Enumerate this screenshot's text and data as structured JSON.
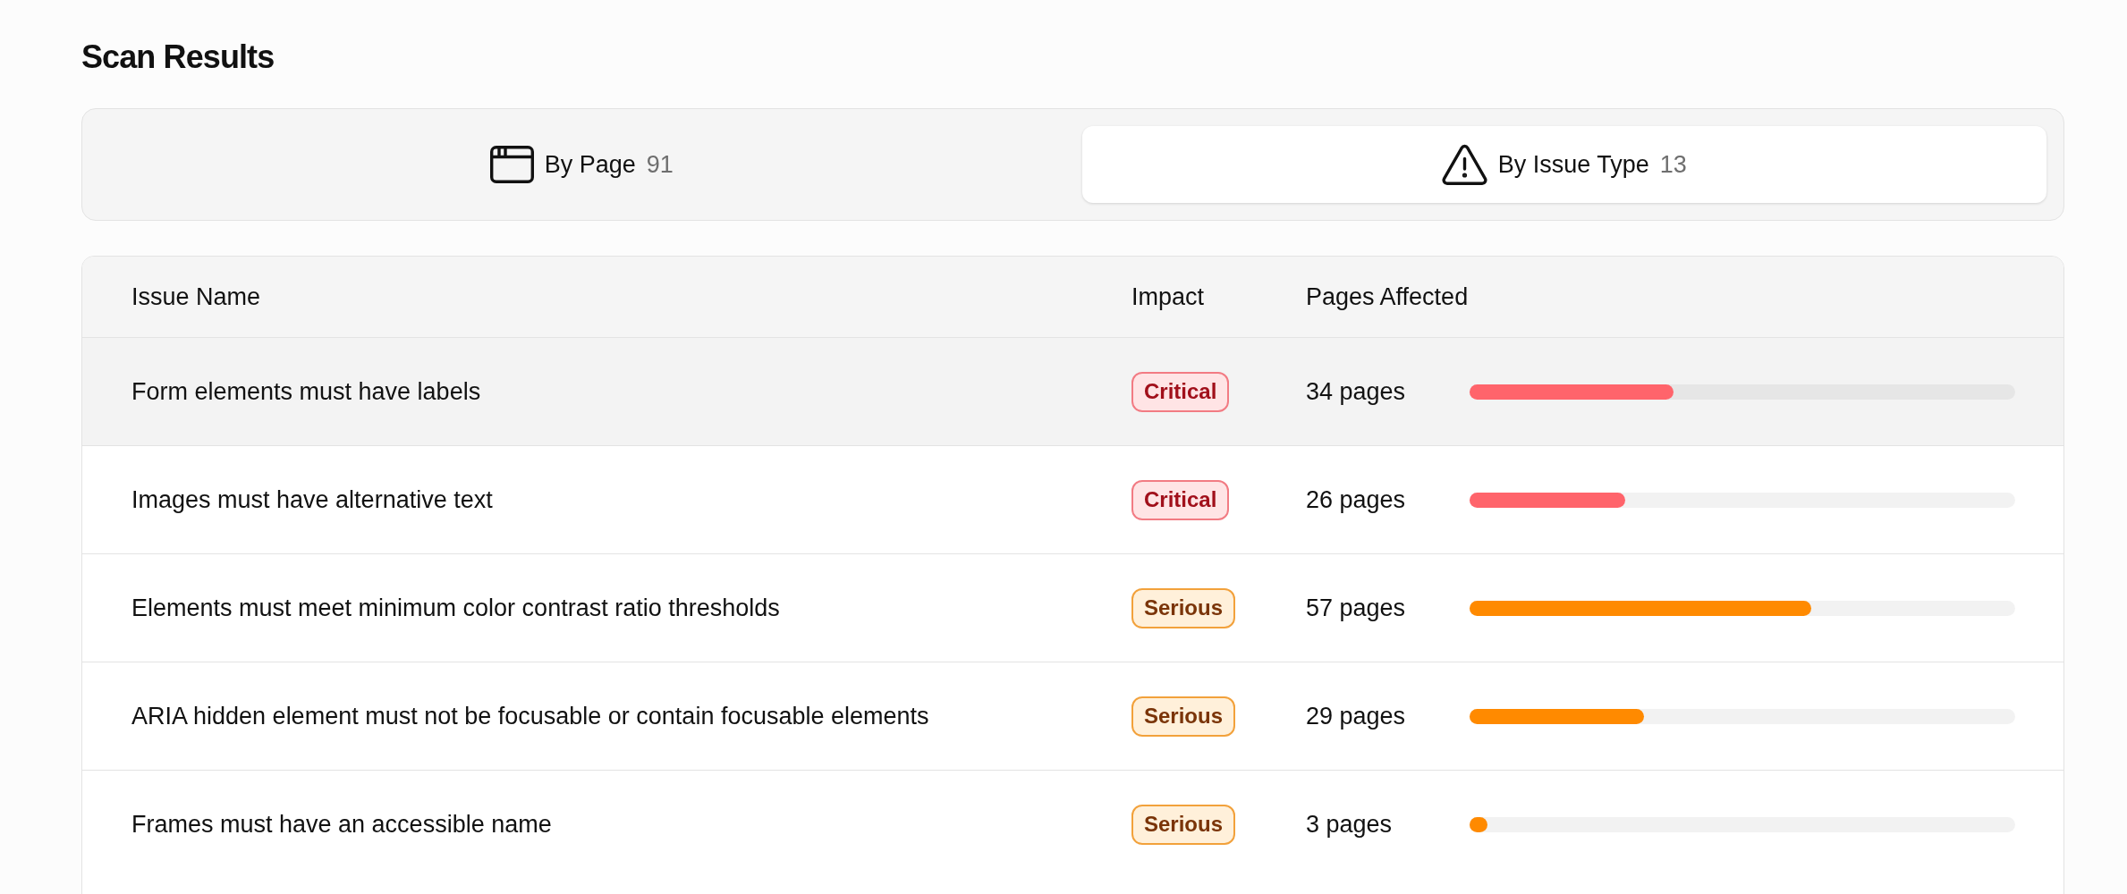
{
  "title": "Scan Results",
  "tabs": [
    {
      "kind": "page",
      "label": "By Page",
      "count": "91",
      "selected": false
    },
    {
      "kind": "issue",
      "label": "By Issue Type",
      "count": "13",
      "selected": true
    }
  ],
  "table": {
    "columns": [
      "Issue Name",
      "Impact",
      "Pages Affected"
    ],
    "rows": [
      {
        "name": "Form elements must have labels",
        "impact": {
          "label": "Critical",
          "kind": "critical"
        },
        "pages": "34 pages",
        "level": 0.374,
        "highlighted": true
      },
      {
        "name": "Images must have alternative text",
        "impact": {
          "label": "Critical",
          "kind": "critical"
        },
        "pages": "26 pages",
        "level": 0.286,
        "highlighted": false
      },
      {
        "name": "Elements must meet minimum color contrast ratio thresholds",
        "impact": {
          "label": "Serious",
          "kind": "serious"
        },
        "pages": "57 pages",
        "level": 0.626,
        "highlighted": false
      },
      {
        "name": "ARIA hidden element must not be focusable or contain focusable elements",
        "impact": {
          "label": "Serious",
          "kind": "serious"
        },
        "pages": "29 pages",
        "level": 0.319,
        "highlighted": false
      },
      {
        "name": "Frames must have an accessible name",
        "impact": {
          "label": "Serious",
          "kind": "serious"
        },
        "pages": "3 pages",
        "level": 0.033,
        "highlighted": false
      }
    ]
  }
}
